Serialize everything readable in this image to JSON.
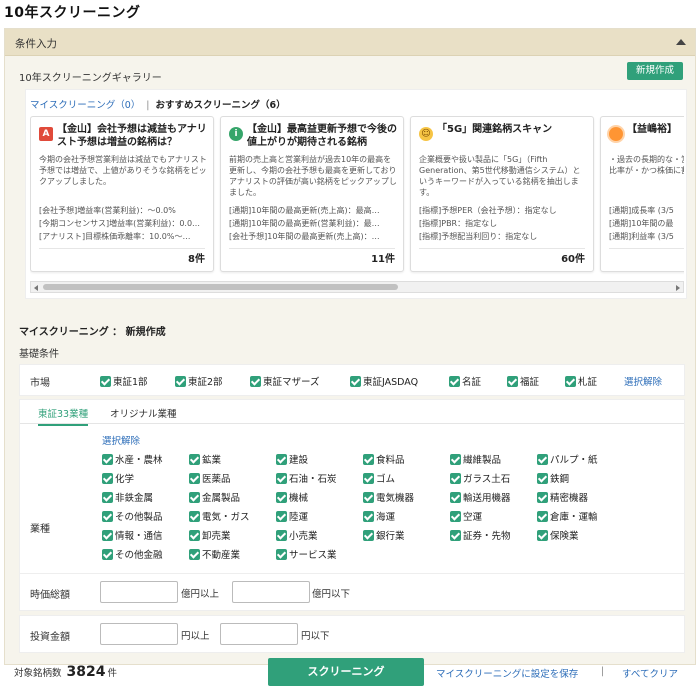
{
  "page_title": "10年スクリーニング",
  "conditions": {
    "header_label": "条件入力",
    "gallery_title": "10年スクリーニングギャラリー",
    "new_button_label": "新規作成"
  },
  "gallery": {
    "tab_my": "マイスクリーニング（0）",
    "tab_separator": "|",
    "tab_recommended": "おすすめスクリーニング（6）",
    "cards": [
      {
        "icon_name": "alert-icon",
        "icon_text": "A",
        "title": "【金山】会社予想は減益もアナリスト予想は増益の銘柄は？",
        "desc": "今期の会社予想営業利益は減益でもアナリスト予想では増益で、上値がありそうな銘柄をピックアップしました。",
        "conditions": [
          "[会社予想]増益率(営業利益)：～0.0%",
          "[今期コンセンサス]増益率(営業利益)：0.0…",
          "[アナリスト]目標株価乖離率：10.0%～…"
        ],
        "count": "8件"
      },
      {
        "icon_name": "info-icon",
        "icon_text": "i",
        "title": "【金山】最高益更新予想で今後の値上がりが期待される銘柄",
        "desc": "前期の売上高と営業利益が過去10年の最高を更新し、今期の会社予想も最高を更新しておりアナリストの評価が高い銘柄をピックアップしました。",
        "conditions": [
          "[通期]10年間の最高更新(売上高)：最高…",
          "[通期]10年間の最高更新(営業利益)：最…",
          "[会社予想]10年間の最高更新(売上高)：…"
        ],
        "count": "11件"
      },
      {
        "icon_name": "smile-icon",
        "icon_text": "☺",
        "title": "「5G」関連銘柄スキャン",
        "desc": "企業概要や扱い製品に「5G」（Fifth Generation、第5世代移動通信システム）というキーワードが入っている銘柄を抽出します。",
        "conditions": [
          "[指標]予想PER（会社予想）：指定なし",
          "[指標]PBR：指定なし",
          "[指標]予想配当利回り：指定なし"
        ],
        "count": "60件"
      },
      {
        "icon_name": "sun-icon",
        "icon_text": "",
        "title": "【益嶋裕】",
        "desc": "・過去の長期的な・営業利益率を示・自己資本比率が・かつ株価に割高",
        "conditions": [
          "[通期]成長率 (3/5",
          "[通期]10年間の最",
          "[通期]利益率 (3/5"
        ],
        "count": ""
      }
    ]
  },
  "my_screening": {
    "heading": "マイスクリーニング ： 新規作成",
    "basic_label": "基礎条件",
    "market_label": "市場",
    "markets": [
      "東証1部",
      "東証2部",
      "東証マザーズ",
      "東証JASDAQ",
      "名証",
      "福証",
      "札証"
    ],
    "market_clear": "選択解除",
    "industry_tabs": [
      "東証33業種",
      "オリジナル業種"
    ],
    "industry_clear": "選択解除",
    "industry_label": "業種",
    "industries": [
      "水産・農林",
      "鉱業",
      "建設",
      "食料品",
      "繊維製品",
      "パルプ・紙",
      "化学",
      "医薬品",
      "石油・石炭",
      "ゴム",
      "ガラス土石",
      "鉄鋼",
      "非鉄金属",
      "金属製品",
      "機械",
      "電気機器",
      "輸送用機器",
      "精密機器",
      "その他製品",
      "電気・ガス",
      "陸運",
      "海運",
      "空運",
      "倉庫・運輸",
      "情報・通信",
      "卸売業",
      "小売業",
      "銀行業",
      "証券・先物",
      "保険業",
      "その他金融",
      "不動産業",
      "サービス業"
    ],
    "market_cap": {
      "label": "時価総額",
      "unit_min": "億円以上",
      "unit_max": "億円以下"
    },
    "investment": {
      "label": "投資金額",
      "unit_min": "円以上",
      "unit_max": "円以下"
    }
  },
  "footer": {
    "count_label": "対象銘柄数",
    "count_value": "3824",
    "count_unit": "件",
    "screening_button": "スクリーニング",
    "save_link": "マイスクリーニングに設定を保存",
    "separator": "|",
    "clear_all": "すべてクリア"
  },
  "colors": {
    "accent_green": "#30a07a",
    "link_blue": "#2b6cb8",
    "header_beige": "#e9e0c6"
  }
}
